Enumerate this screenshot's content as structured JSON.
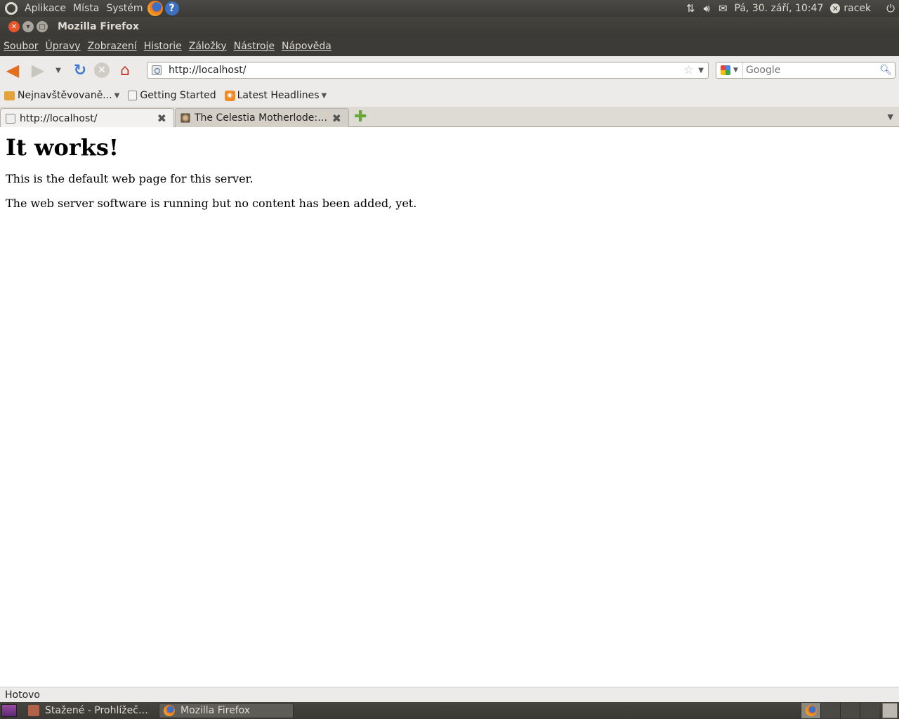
{
  "top_panel": {
    "menus": [
      "Aplikace",
      "Místa",
      "Systém"
    ],
    "clock": "Pá, 30. září, 10:47",
    "user": "racek",
    "help_glyph": "?"
  },
  "window": {
    "title": "Mozilla Firefox"
  },
  "menubar": [
    "Soubor",
    "Úpravy",
    "Zobrazení",
    "Historie",
    "Záložky",
    "Nástroje",
    "Nápověda"
  ],
  "navbar": {
    "url": "http://localhost/",
    "search_placeholder": "Google"
  },
  "bookmarks": [
    {
      "label": "Nejnavštěvovaně...",
      "icon": "folder-icon"
    },
    {
      "label": "Getting Started",
      "icon": "page-icon"
    },
    {
      "label": "Latest Headlines",
      "icon": "rss-icon"
    }
  ],
  "tabs": [
    {
      "label": "http://localhost/",
      "active": true
    },
    {
      "label": "The Celestia Motherlode: E...",
      "active": false
    }
  ],
  "content": {
    "heading": "It works!",
    "paragraph1": "This is the default web page for this server.",
    "paragraph2": "The web server software is running but no content has been added, yet."
  },
  "status": "Hotovo",
  "taskbar": [
    {
      "label": "Stažené - Prohlížeč so...",
      "icon": "folder-icon"
    },
    {
      "label": "Mozilla Firefox",
      "icon": "firefox-icon"
    }
  ]
}
